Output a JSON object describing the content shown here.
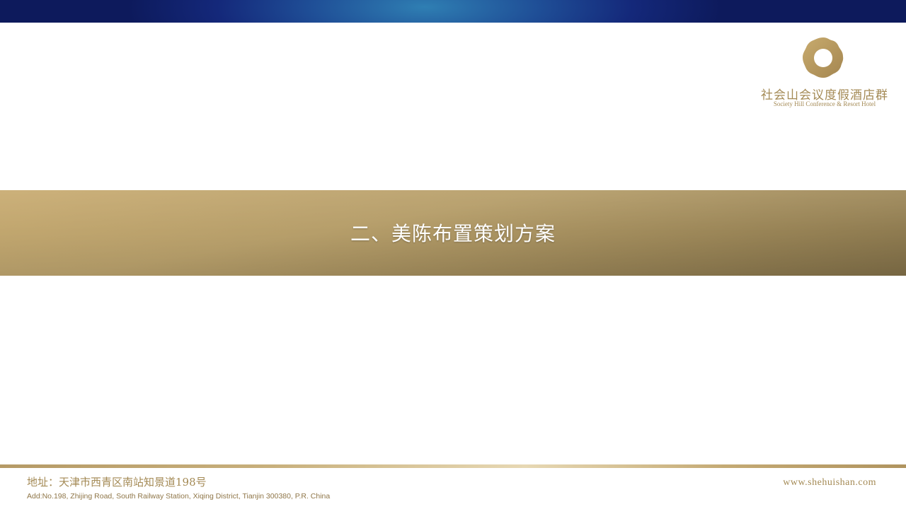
{
  "header": {
    "brand_color": "#14287a"
  },
  "logo": {
    "name_cn": "社会山会议度假酒店群",
    "name_en": "Society Hill Conference & Resort Hotel",
    "color": "#a48a55"
  },
  "slide": {
    "title": "二、美陈布置策划方案",
    "band_color": "#b69e6a"
  },
  "footer": {
    "address_cn": "地址：天津市西青区南站知景道198号",
    "address_en": "Add:No.198, Zhijing Road, South Railway Station, Xiqing District, Tianjin 300380, P.R. China",
    "website": "www.shehuishan.com"
  }
}
